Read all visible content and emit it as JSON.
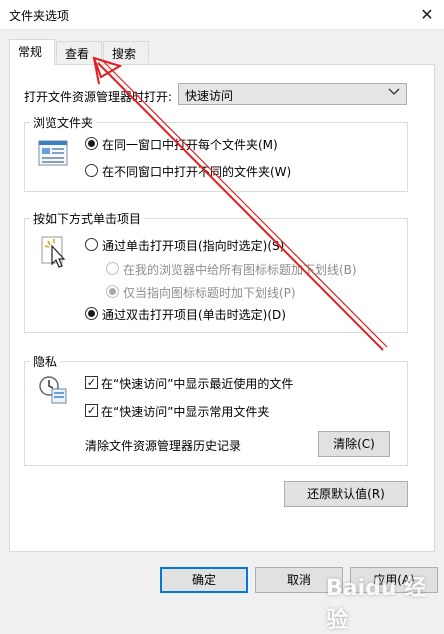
{
  "window": {
    "title": "文件夹选项",
    "close_glyph": "✕"
  },
  "tabs": [
    {
      "label": "常规",
      "active": true
    },
    {
      "label": "查看",
      "active": false
    },
    {
      "label": "搜索",
      "active": false
    }
  ],
  "open_explorer": {
    "label": "打开文件资源管理器时打开:",
    "value": "快速访问"
  },
  "browse_folders": {
    "title": "浏览文件夹",
    "options": [
      {
        "label": "在同一窗口中打开每个文件夹(M)",
        "checked": true
      },
      {
        "label": "在不同窗口中打开不同的文件夹(W)",
        "checked": false
      }
    ]
  },
  "click_items": {
    "title": "按如下方式单击项目",
    "single_click": {
      "label": "通过单击打开项目(指向时选定)(S)",
      "checked": false
    },
    "underline_all": {
      "label": "在我的浏览器中给所有图标标题加下划线(B)",
      "checked": false,
      "disabled": true
    },
    "underline_hover": {
      "label": "仅当指向图标标题时加下划线(P)",
      "checked": true,
      "disabled": true
    },
    "double_click": {
      "label": "通过双击打开项目(单击时选定)(D)",
      "checked": true
    }
  },
  "privacy": {
    "title": "隐私",
    "show_recent": {
      "label": "在“快速访问”中显示最近使用的文件",
      "checked": true
    },
    "show_frequent": {
      "label": "在“快速访问”中显示常用文件夹",
      "checked": true
    },
    "clear_history_label": "清除文件资源管理器历史记录",
    "clear_button": "清除(C)",
    "check_glyph": "✓"
  },
  "restore_defaults": "还原默认值(R)",
  "footer": {
    "ok": "确定",
    "cancel": "取消",
    "apply": "应用(A)"
  },
  "watermark": "Baidu 经验",
  "colors": {
    "annotation_arrow": "#e02020",
    "focus_blue": "#0078d7"
  }
}
